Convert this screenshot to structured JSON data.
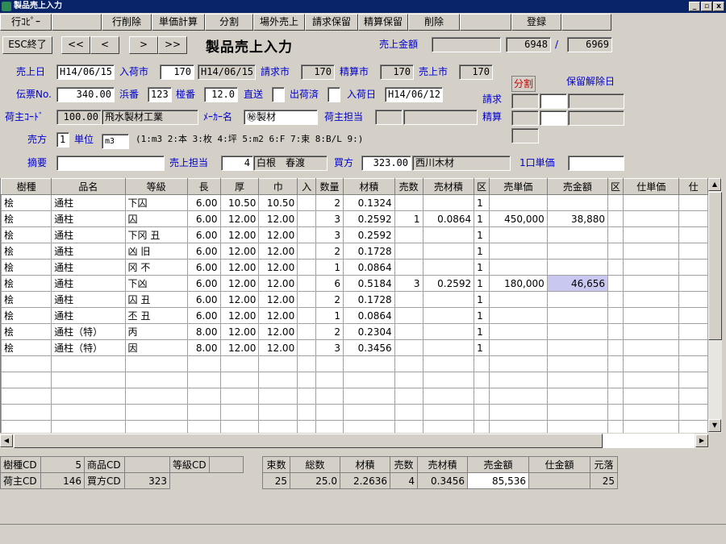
{
  "window": {
    "title": "製品売上入力",
    "controls": [
      "_",
      "▫",
      "x"
    ]
  },
  "toolbar": {
    "row_copy": "行ｺﾋﾟｰ",
    "row_delete": "行削除",
    "unit_calc": "単価計算",
    "split": "分割",
    "offsite_sale": "場外売上",
    "bill_hold": "請求保留",
    "settle_hold": "精算保留",
    "delete": "削除",
    "register": "登録"
  },
  "nav": {
    "esc": "ESC終了",
    "first": "<<",
    "prev": "<",
    "next": ">",
    "last": ">>"
  },
  "title": "製品売上入力",
  "header": {
    "sales_amount_label": "売上金額",
    "sales_amount_value": "",
    "count_current": "6948",
    "slash": "/",
    "count_total": "6969",
    "sales_date_label": "売上日",
    "sales_date": "H14/06/15",
    "arrival_market_label": "入荷市",
    "arrival_market": "170",
    "arrival_market_date": "H14/06/15",
    "billing_market_label": "請求市",
    "billing_market": "170",
    "settle_market_label": "精算市",
    "settle_market": "170",
    "sales_market_label": "売上市",
    "sales_market": "170",
    "slip_label": "伝票No.",
    "slip_no": "340.00",
    "beach_label": "浜番",
    "beach_no": "123",
    "stack_label": "椪番",
    "stack_no": "12.0",
    "direct_label": "直送",
    "shipped_label": "出荷済",
    "arrival_date_label": "入荷日",
    "arrival_date": "H14/06/12",
    "shipper_code_label": "荷主ｺｰﾄﾞ",
    "shipper_code": "100.00",
    "shipper_name": "飛水製材工業",
    "maker_label": "ﾒｰｶｰ名",
    "maker_name": "㊙製材",
    "shipper_staff_label": "荷主担当",
    "seller_label": "売方",
    "seller_value": "1",
    "unit_label": "単位",
    "unit_value": "m3",
    "unit_legend": "(1:m3 2:本 3:枚 4:坪 5:m2 6:F 7:束 8:B/L 9:)",
    "summary_label": "摘要",
    "sales_staff_label": "売上担当",
    "sales_staff_code": "4",
    "sales_staff_name": "白根　春渡",
    "buyer_label": "買方",
    "buyer_code": "323.00",
    "buyer_name": "西川木材",
    "unit_price_label": "1口単価",
    "split_label": "分割",
    "release_date_label": "保留解除日",
    "billing_label": "請求",
    "settlement_label": "精算"
  },
  "grid": {
    "columns": [
      "樹種",
      "品名",
      "等級",
      "長",
      "厚",
      "巾",
      "入",
      "数量",
      "材積",
      "売数",
      "売材積",
      "区",
      "売単価",
      "売金額",
      "区",
      "仕単価",
      "仕"
    ],
    "rows": [
      [
        "桧",
        "通柱",
        "下囚",
        "6.00",
        "10.50",
        "10.50",
        "",
        "2",
        "0.1324",
        "",
        "",
        "1",
        "",
        "",
        "",
        "",
        ""
      ],
      [
        "桧",
        "通柱",
        "囚",
        "6.00",
        "12.00",
        "12.00",
        "",
        "3",
        "0.2592",
        "1",
        "0.0864",
        "1",
        "450,000",
        "38,880",
        "",
        "",
        ""
      ],
      [
        "桧",
        "通柱",
        "下冈 丑",
        "6.00",
        "12.00",
        "12.00",
        "",
        "3",
        "0.2592",
        "",
        "",
        "1",
        "",
        "",
        "",
        "",
        ""
      ],
      [
        "桧",
        "通柱",
        "凶 旧",
        "6.00",
        "12.00",
        "12.00",
        "",
        "2",
        "0.1728",
        "",
        "",
        "1",
        "",
        "",
        "",
        "",
        ""
      ],
      [
        "桧",
        "通柱",
        "冈 不",
        "6.00",
        "12.00",
        "12.00",
        "",
        "1",
        "0.0864",
        "",
        "",
        "1",
        "",
        "",
        "",
        "",
        ""
      ],
      [
        "桧",
        "通柱",
        "下凶",
        "6.00",
        "12.00",
        "12.00",
        "",
        "6",
        "0.5184",
        "3",
        "0.2592",
        "1",
        "180,000",
        "46,656",
        "",
        "",
        ""
      ],
      [
        "桧",
        "通柱",
        "囚 丑",
        "6.00",
        "12.00",
        "12.00",
        "",
        "2",
        "0.1728",
        "",
        "",
        "1",
        "",
        "",
        "",
        "",
        ""
      ],
      [
        "桧",
        "通柱",
        "丕 丑",
        "6.00",
        "12.00",
        "12.00",
        "",
        "1",
        "0.0864",
        "",
        "",
        "1",
        "",
        "",
        "",
        "",
        ""
      ],
      [
        "桧",
        "通柱（特）",
        "丙",
        "8.00",
        "12.00",
        "12.00",
        "",
        "2",
        "0.2304",
        "",
        "",
        "1",
        "",
        "",
        "",
        "",
        ""
      ],
      [
        "桧",
        "通柱（特）",
        "因",
        "8.00",
        "12.00",
        "12.00",
        "",
        "3",
        "0.3456",
        "",
        "",
        "1",
        "",
        "",
        "",
        "",
        ""
      ]
    ],
    "empty_rows": 5,
    "highlight": {
      "row": 5,
      "col": 13
    }
  },
  "footer": {
    "species_cd_label": "樹種CD",
    "species_cd": "5",
    "product_cd_label": "商品CD",
    "product_cd": "",
    "grade_cd_label": "等級CD",
    "grade_cd": "",
    "shipper_cd_label": "荷主CD",
    "shipper_cd": "146",
    "buyer_cd_label": "買方CD",
    "buyer_cd": "323",
    "totals_headers": [
      "束数",
      "総数",
      "材積",
      "売数",
      "売材積",
      "売金額",
      "仕金額",
      "元落"
    ],
    "totals_values": [
      "25",
      "25.0",
      "2.2636",
      "4",
      "0.3456",
      "85,536",
      "",
      "25"
    ]
  }
}
